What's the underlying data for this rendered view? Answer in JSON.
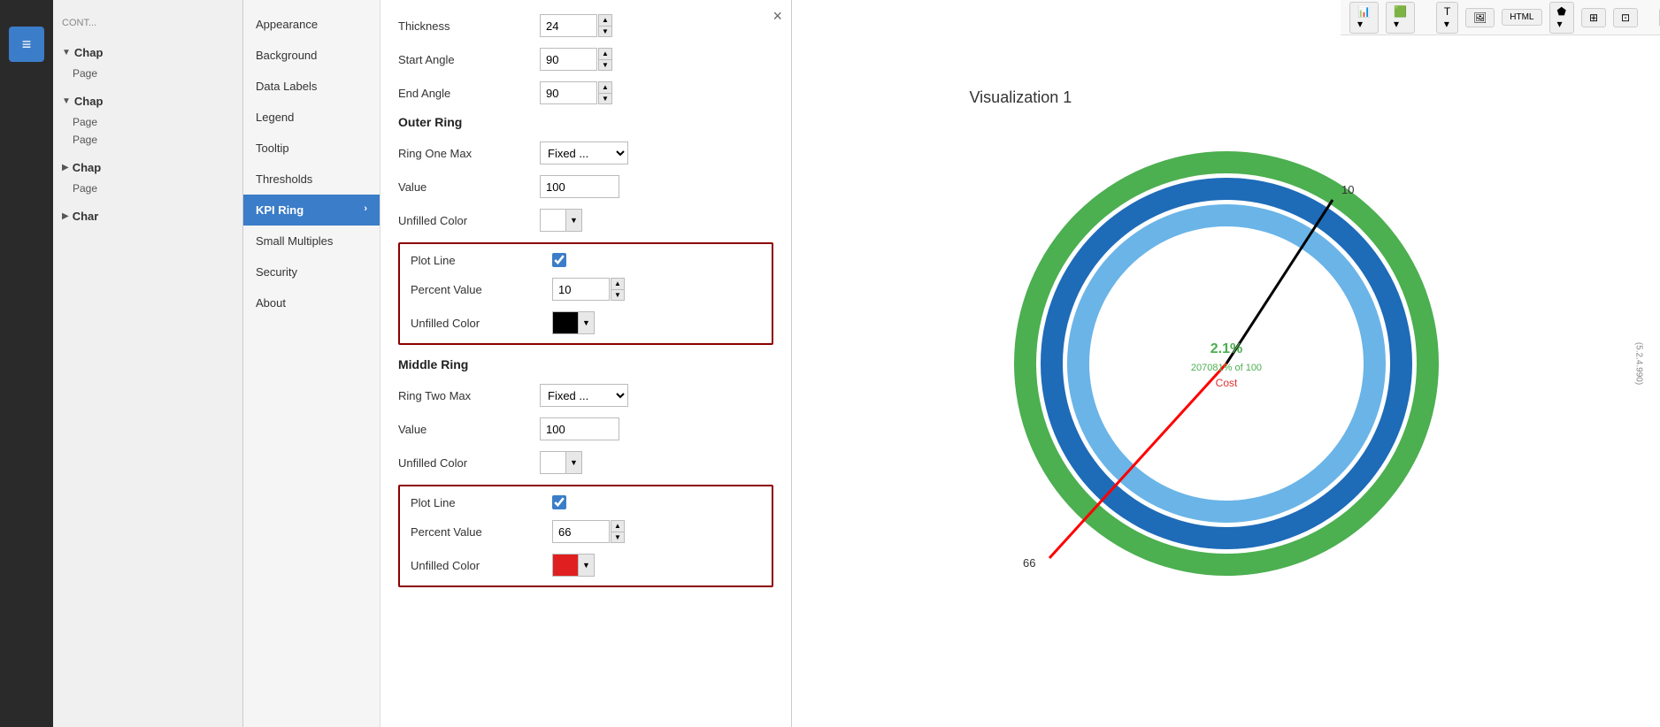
{
  "app": {
    "title": "Visualization 1",
    "version": "(5.2.4.990)"
  },
  "toolbar": {
    "buttons": [
      {
        "label": "📊 ▾",
        "name": "chart-btn"
      },
      {
        "label": "🟢 ▾",
        "name": "color-btn"
      },
      {
        "label": "T ▾",
        "name": "text-btn"
      },
      {
        "label": "🖼",
        "name": "image-btn"
      },
      {
        "label": "HTML",
        "name": "html-btn"
      },
      {
        "label": "⬟ ▾",
        "name": "shape-btn"
      },
      {
        "label": "⊞",
        "name": "grid-btn"
      },
      {
        "label": "⊡",
        "name": "box-btn"
      },
      {
        "label": "◻",
        "name": "frame-btn"
      },
      {
        "label": "☀",
        "name": "sun-btn"
      },
      {
        "label": "▭",
        "name": "rect-btn"
      },
      {
        "label": "☐",
        "name": "square-btn"
      },
      {
        "label": "⊠",
        "name": "close2-btn"
      },
      {
        "label": "🔴",
        "name": "red-btn"
      },
      {
        "label": "⊡2",
        "name": "box2-btn"
      }
    ]
  },
  "nav_panel": {
    "chapters": [
      {
        "name": "Chap",
        "expanded": true,
        "subitems": [
          "Page"
        ]
      },
      {
        "name": "Chap",
        "expanded": true,
        "subitems": [
          "Page",
          "Page"
        ]
      },
      {
        "name": "Chap",
        "expanded": false,
        "subitems": [
          "Page"
        ]
      },
      {
        "name": "Char",
        "expanded": false,
        "subitems": []
      }
    ]
  },
  "settings": {
    "nav_items": [
      {
        "label": "Appearance",
        "active": false
      },
      {
        "label": "Background",
        "active": false
      },
      {
        "label": "Data Labels",
        "active": false
      },
      {
        "label": "Legend",
        "active": false
      },
      {
        "label": "Tooltip",
        "active": false
      },
      {
        "label": "Thresholds",
        "active": false
      },
      {
        "label": "KPI Ring",
        "active": true,
        "has_arrow": true
      },
      {
        "label": "Small Multiples",
        "active": false
      },
      {
        "label": "Security",
        "active": false
      },
      {
        "label": "About",
        "active": false
      }
    ],
    "content": {
      "thickness_label": "Thickness",
      "thickness_value": "24",
      "start_angle_label": "Start Angle",
      "start_angle_value": "90",
      "end_angle_label": "End Angle",
      "end_angle_value": "90",
      "outer_ring_title": "Outer Ring",
      "ring_one_max_label": "Ring One Max",
      "ring_one_max_value": "Fixed ...",
      "outer_value_label": "Value",
      "outer_value": "100",
      "outer_unfilled_label": "Unfilled Color",
      "outer_plotline_label": "Plot Line",
      "outer_percent_label": "Percent Value",
      "outer_percent_value": "10",
      "outer_unfilled2_label": "Unfilled Color",
      "middle_ring_title": "Middle Ring",
      "ring_two_max_label": "Ring Two Max",
      "ring_two_max_value": "Fixed ...",
      "middle_value_label": "Value",
      "middle_value": "100",
      "middle_unfilled_label": "Unfilled Color",
      "middle_plotline_label": "Plot Line",
      "middle_percent_label": "Percent Value",
      "middle_percent_value": "66",
      "middle_unfilled2_label": "Unfilled Color"
    }
  },
  "visualization": {
    "title": "Visualization 1",
    "center_value": "2.1%",
    "center_subvalue": "207081% of 100",
    "center_label": "Cost",
    "marker_10": "10",
    "marker_66": "66",
    "rings": {
      "outer_color": "#4caf50",
      "middle_color": "#1e6bb8",
      "inner_color": "#6ab4e8",
      "center_color": "white"
    },
    "needle_black_end": "10",
    "needle_red_end": "66"
  },
  "close_label": "×"
}
